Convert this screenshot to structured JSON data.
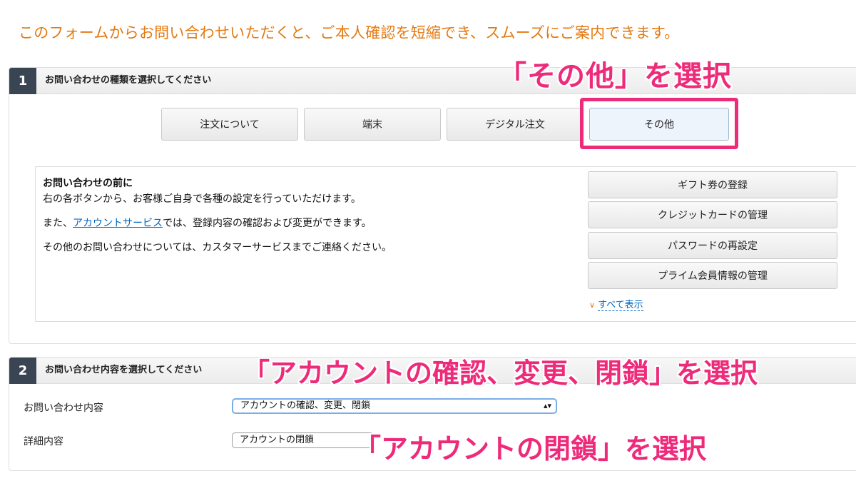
{
  "intro_text": "このフォームからお問い合わせいただくと、ご本人確認を短縮でき、スムーズにご案内できます。",
  "section1": {
    "number": "1",
    "title": "お問い合わせの種類を選択してください",
    "categories": [
      "注文について",
      "端末",
      "デジタル注文",
      "その他"
    ],
    "selected_category": "その他",
    "info": {
      "heading": "お問い合わせの前に",
      "line1": "右の各ボタンから、お客様ご自身で各種の設定を行っていただけます。",
      "line2_prefix": "また、",
      "line2_link": "アカウントサービス",
      "line2_suffix": "では、登録内容の確認および変更ができます。",
      "line3": "その他のお問い合わせについては、カスタマーサービスまでご連絡ください。"
    },
    "side_buttons": [
      "ギフト券の登録",
      "クレジットカードの管理",
      "パスワードの再設定",
      "プライム会員情報の管理"
    ],
    "show_all_label": "すべて表示"
  },
  "section2": {
    "number": "2",
    "title": "お問い合わせ内容を選択してください",
    "inquiry_label": "お問い合わせ内容",
    "inquiry_value": "アカウントの確認、変更、閉鎖",
    "detail_label": "詳細内容",
    "detail_value": "アカウントの閉鎖"
  },
  "annotations": {
    "select_other": "「その他」を選択",
    "select_account": "「アカウントの確認、変更、閉鎖」を選択",
    "select_close": "「アカウントの閉鎖」を選択"
  },
  "colors": {
    "accent_orange": "#e47911",
    "annotation_pink": "#ee2b7a",
    "link_blue": "#0066c0",
    "section_number_bg": "#3a4553"
  }
}
